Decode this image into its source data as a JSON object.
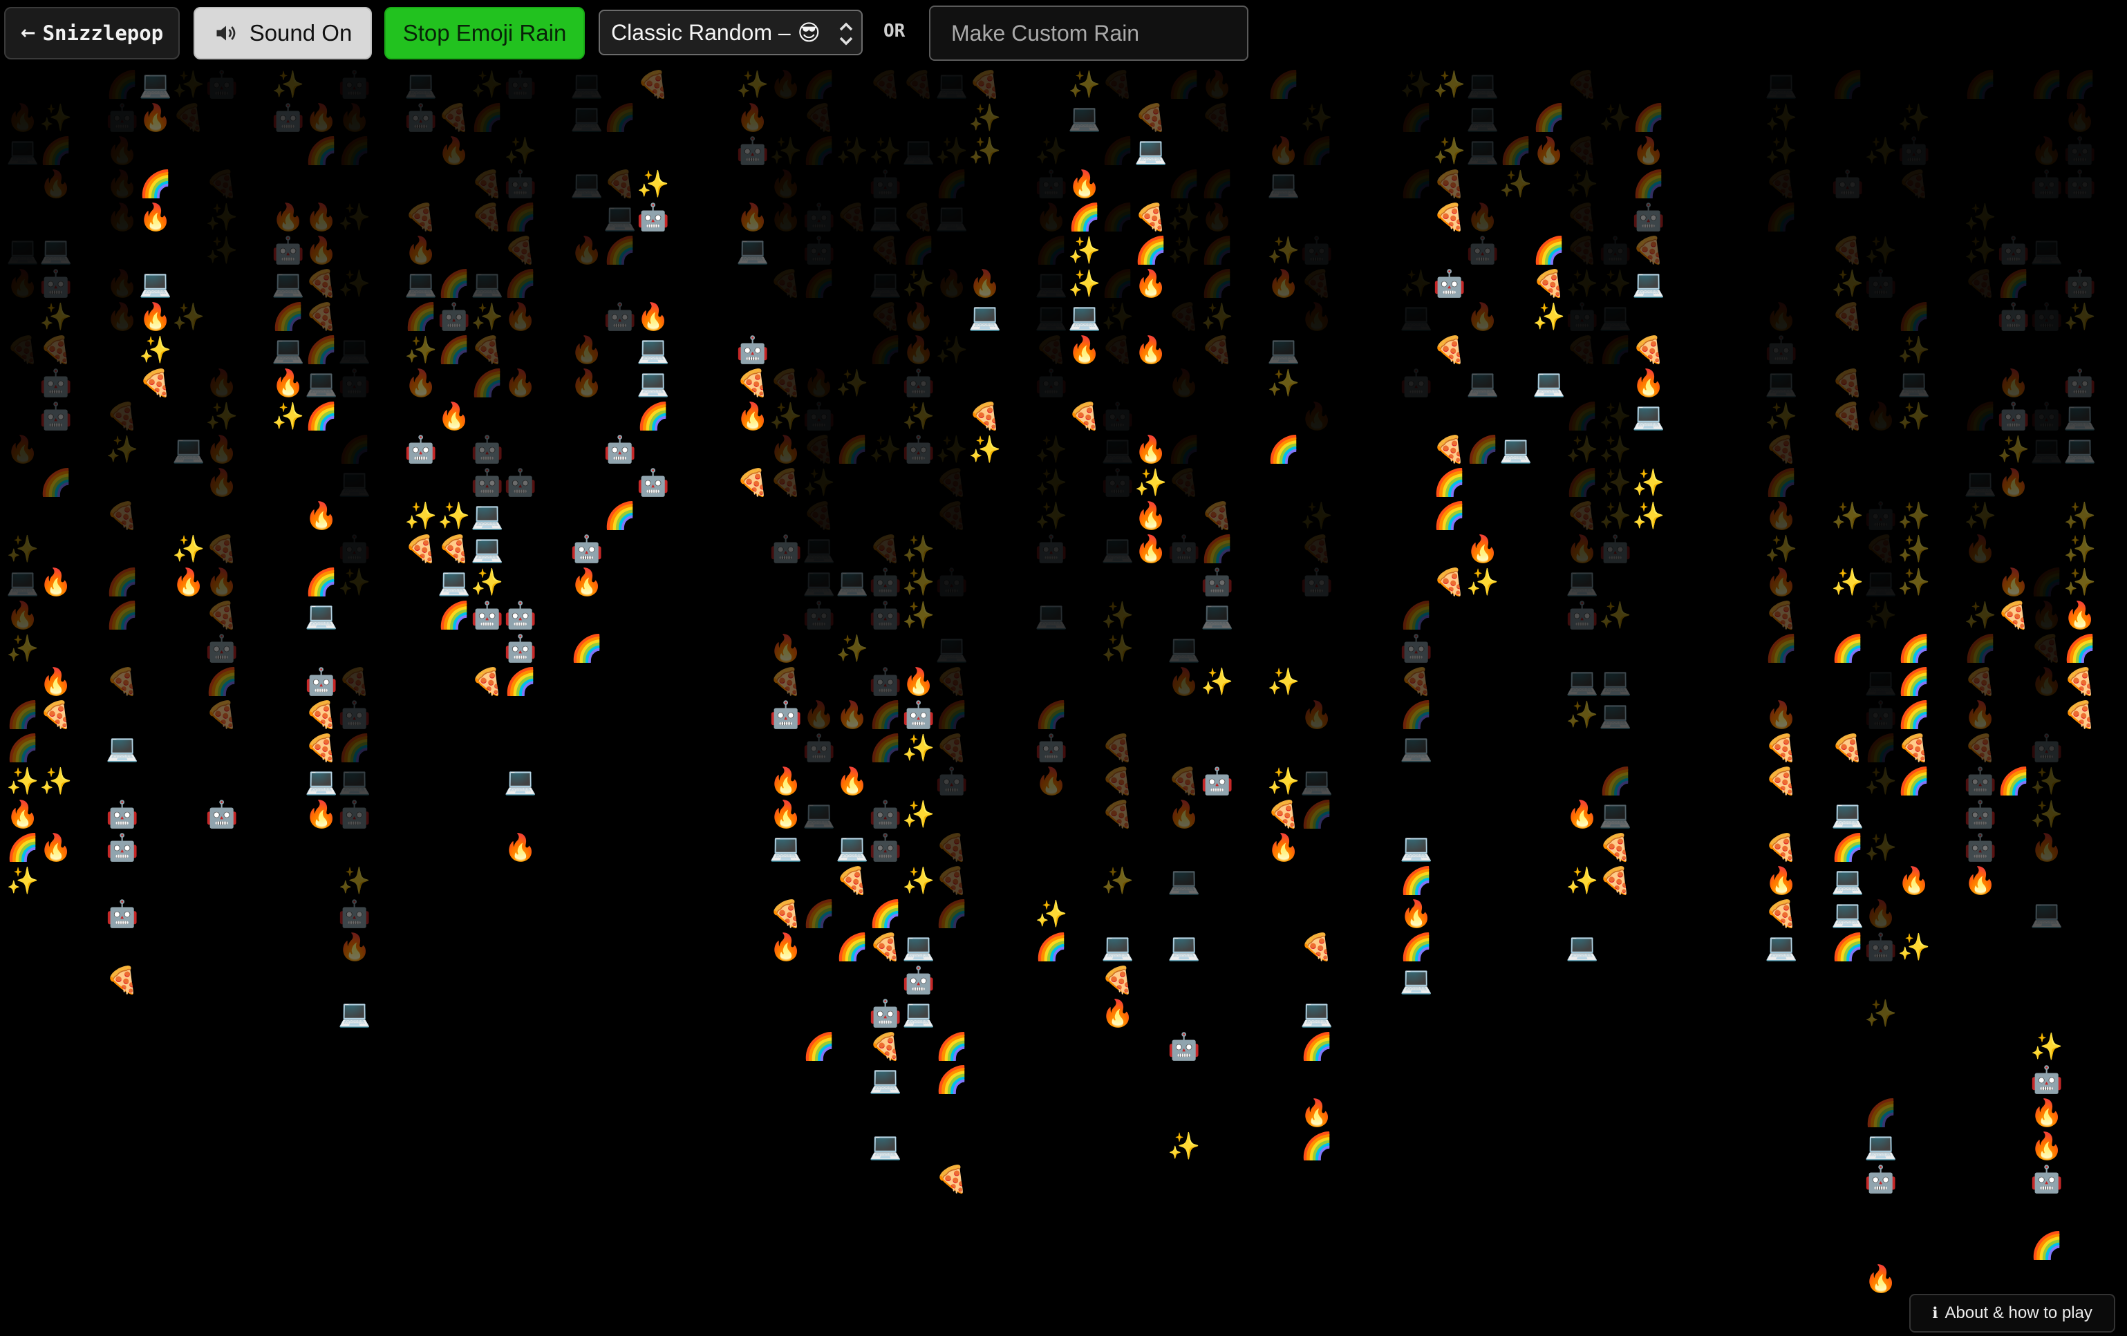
{
  "toolbar": {
    "back_label": "Snizzlepop",
    "back_arrow": "←",
    "sound_label": "Sound On",
    "stop_label": "Stop Emoji Rain",
    "mode_label": "Classic Random –",
    "mode_emoji": "😎",
    "or_label": "OR",
    "custom_placeholder": "Make Custom Rain"
  },
  "about": {
    "label": "About & how to play",
    "icon": "ℹ"
  },
  "colors": {
    "background": "#000000",
    "stop_button": "#22c21f",
    "sound_button": "#d8d8d8"
  },
  "rain": {
    "emoji_set": [
      "😀",
      "✨",
      "⚡",
      "🤖",
      "🔥",
      "💻",
      "☔",
      "🍕",
      "😎",
      "🌈"
    ]
  }
}
